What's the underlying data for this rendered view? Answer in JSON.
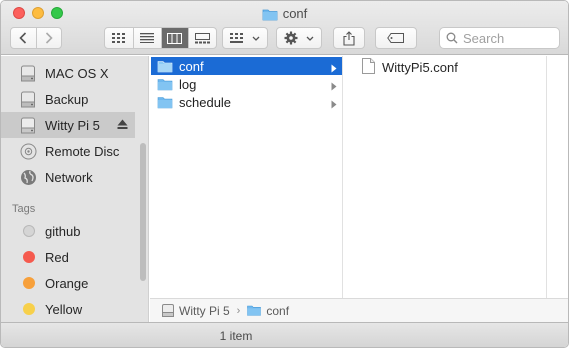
{
  "window": {
    "title": "conf"
  },
  "toolbar": {
    "search_placeholder": "Search"
  },
  "sidebar": {
    "devices": [
      {
        "label": "MAC OS X",
        "icon": "hard-drive-icon"
      },
      {
        "label": "Backup",
        "icon": "hard-drive-icon"
      },
      {
        "label": "Witty Pi 5",
        "icon": "removable-drive-icon",
        "selected": true
      },
      {
        "label": "Remote Disc",
        "icon": "disc-icon"
      },
      {
        "label": "Network",
        "icon": "globe-icon"
      }
    ],
    "tags_header": "Tags",
    "tags": [
      {
        "label": "github",
        "color": "#d5d5d5"
      },
      {
        "label": "Red",
        "color": "#f55a4e"
      },
      {
        "label": "Orange",
        "color": "#f7a03b"
      },
      {
        "label": "Yellow",
        "color": "#f7d04b"
      }
    ]
  },
  "columns": {
    "col1": [
      {
        "name": "conf",
        "selected": true
      },
      {
        "name": "log",
        "selected": false
      },
      {
        "name": "schedule",
        "selected": false
      }
    ],
    "col2": [
      {
        "name": "WittyPi5.conf"
      }
    ]
  },
  "pathbar": {
    "drive": "Witty Pi 5",
    "folder": "conf"
  },
  "status": {
    "text": "1 item"
  },
  "colors": {
    "selection": "#1b6bd5",
    "folder": "#6fb8ee"
  }
}
